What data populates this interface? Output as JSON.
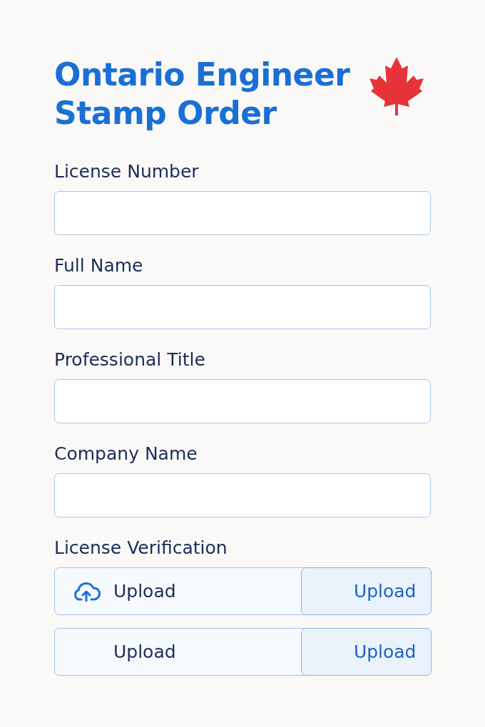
{
  "title": "Ontario Engineer Stamp Order",
  "fields": [
    {
      "label": "License Number"
    },
    {
      "label": "Full Name"
    },
    {
      "label": "Professional Title"
    },
    {
      "label": "Company Name"
    }
  ],
  "verification": {
    "label": "License Verification",
    "uploads": [
      {
        "text": "Upload",
        "button": "Upload",
        "icon": true
      },
      {
        "text": "Upload",
        "button": "Upload",
        "icon": false
      }
    ]
  }
}
